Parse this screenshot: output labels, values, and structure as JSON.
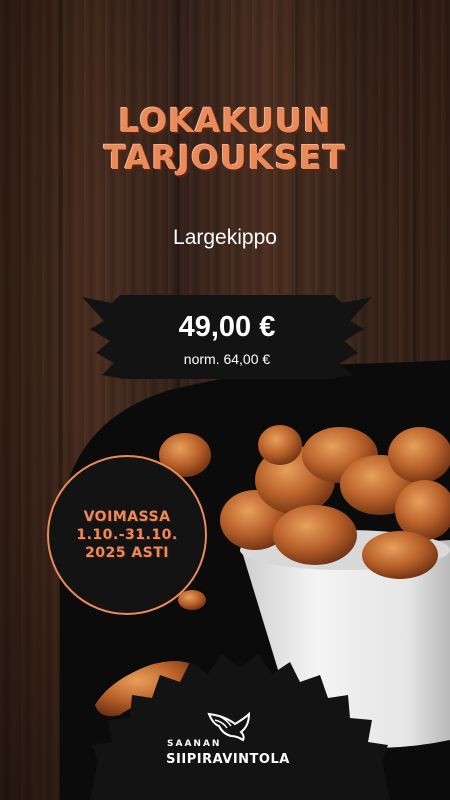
{
  "title": {
    "line1": "LOKAKUUN",
    "line2": "TARJOUKSET"
  },
  "product": {
    "name": "Largekippo"
  },
  "price": {
    "current": "49,00 €",
    "normal": "norm. 64,00 €"
  },
  "validity": {
    "line1": "VOIMASSA",
    "line2": "1.10.-31.10.",
    "line3": "2025 ASTI"
  },
  "logo": {
    "top": "SAANAN",
    "main": "SIIPIRAVINTOLA"
  },
  "colors": {
    "accent": "#e98a5a",
    "badge": "#141313",
    "text": "#ffffff"
  }
}
